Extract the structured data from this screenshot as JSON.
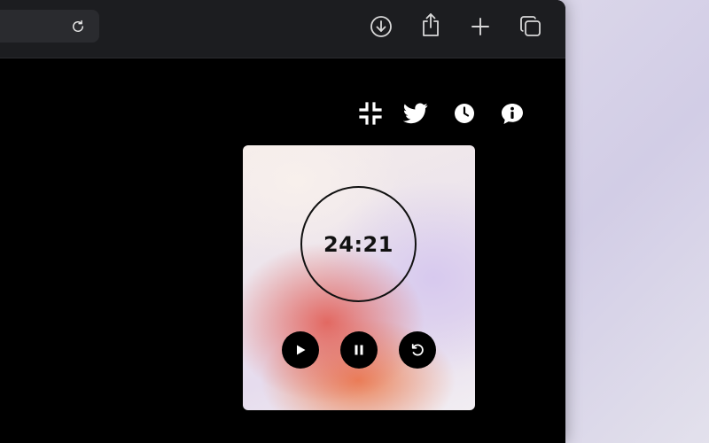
{
  "browser": {
    "toolbar_icons": [
      "reload-icon",
      "download-icon",
      "share-icon",
      "new-tab-icon",
      "tab-overview-icon"
    ]
  },
  "page": {
    "top_icons": [
      "compress-icon",
      "twitter-icon",
      "clock-icon",
      "info-icon"
    ],
    "timer": {
      "time": "24:21"
    },
    "controls": [
      "play-icon",
      "pause-icon",
      "reset-icon"
    ]
  },
  "colors": {
    "toolbar_bg": "#1c1d20",
    "page_bg": "#000000",
    "accent_red": "#e2625a",
    "accent_lavender": "#d6c8ee"
  }
}
